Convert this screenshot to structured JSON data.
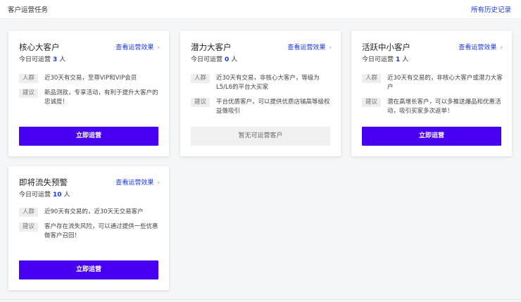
{
  "header": {
    "title": "客户运营任务",
    "history_link": "所有历史记录"
  },
  "cards": [
    {
      "name": "核心大客户",
      "effect_link": "查看运营效果",
      "count_prefix": "今日可运营",
      "count": "3",
      "count_unit": "人",
      "crowd_tag": "人群",
      "crowd_text": "近30天有交易，至尊VIP和VIP会员",
      "suggest_tag": "建议",
      "suggest_text": "新品测款，专享活动，有利于提升大客户的忠诚度！",
      "button": "立即运营",
      "button_state": "active"
    },
    {
      "name": "潜力大客户",
      "effect_link": "查看运营效果",
      "count_prefix": "今日可运营",
      "count": "0",
      "count_unit": "人",
      "crowd_tag": "人群",
      "crowd_text": "近30天有交易，非核心大客户，等级为L5/L6的平台大买家",
      "suggest_tag": "建议",
      "suggest_text": "平台优质客户，可以提供优质店铺高等级权益做吸引",
      "button": "暂无可运营客户",
      "button_state": "disabled"
    },
    {
      "name": "活跃中小客户",
      "effect_link": "查看运营效果",
      "count_prefix": "今日可运营",
      "count": "1",
      "count_unit": "人",
      "crowd_tag": "人群",
      "crowd_text": "近30天有交易的，非核心大客户或潜力大客户",
      "suggest_tag": "建议",
      "suggest_text": "潜在高增长客户，可以多推送爆品和优惠活动，吸引买家多次返单！",
      "button": "立即运营",
      "button_state": "active"
    },
    {
      "name": "即将流失预警",
      "effect_link": "查看运营效果",
      "count_prefix": "今日可运营",
      "count": "10",
      "count_unit": "人",
      "crowd_tag": "人群",
      "crowd_text": "近90天有交易的，近30天无交易客户",
      "suggest_tag": "建议",
      "suggest_text": "客户存在流失风险，可以通过提供一些优惠做客户召回！",
      "button": "立即运营",
      "button_state": "active"
    }
  ],
  "icons": {
    "effect_chevron": "chevron-right-icon"
  },
  "colors": {
    "accent": "#4800f2",
    "link": "#1a39e6",
    "count": "#1a39e6"
  }
}
